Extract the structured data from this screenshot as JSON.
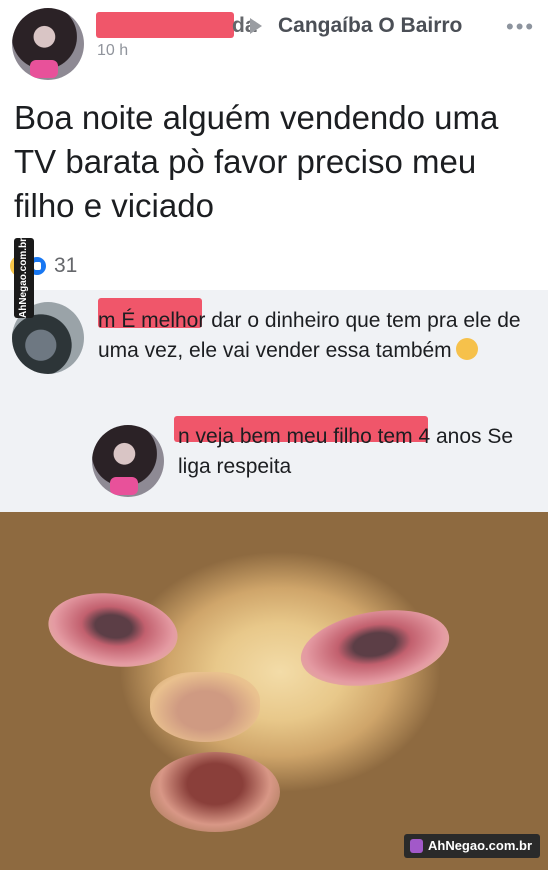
{
  "post": {
    "author_tail": "da",
    "group_name": "Cangaíba O Bairro",
    "more_menu": "•••",
    "timestamp": "10 h",
    "text": "Boa noite alguém vendendo uma TV barata pò favor preciso meu filho e viciado",
    "reactions": {
      "icons": [
        "haha-icon",
        "like-icon"
      ],
      "count": "31"
    }
  },
  "comments": [
    {
      "text": "m É melhor dar o dinheiro que tem pra ele de uma vez, ele vai vender essa também",
      "emoji": "thinking-face-icon"
    },
    {
      "text": "n veja bem meu filho tem 4 anos Se liga respeita"
    }
  ],
  "watermarks": {
    "side": "AhNegao.com.br",
    "bottom": "AhNegao.com.br"
  },
  "colors": {
    "redaction": "#f0566a",
    "comment_bg": "#f0f2f5",
    "like_blue": "#1877f2"
  }
}
